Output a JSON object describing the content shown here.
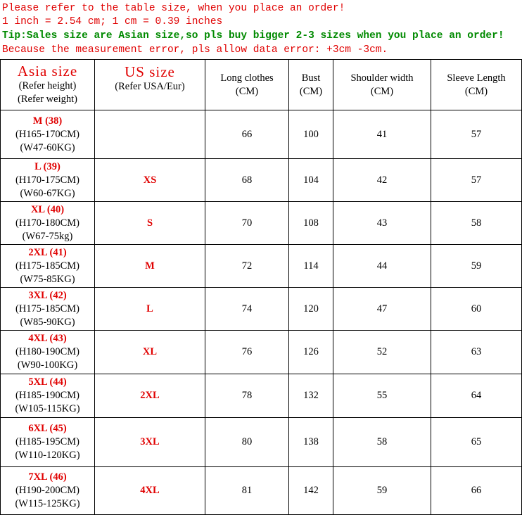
{
  "notes": [
    "Please refer to the table size, when you place an order!",
    "1 inch = 2.54 cm; 1 cm = 0.39 inches",
    "Tip:Sales size are Asian size,so pls buy bigger 2-3 sizes when you place an order!",
    "Because the measurement error, pls allow data error: +3cm -3cm."
  ],
  "header": {
    "asia_title": "Asia size",
    "asia_sub1": "(Refer height)",
    "asia_sub2": "(Refer weight)",
    "us_title": "US size",
    "us_sub": "(Refer USA/Eur)",
    "long_clothes": "Long clothes",
    "long_unit": "(CM)",
    "bust": "Bust",
    "bust_unit": "(CM)",
    "shoulder": "Shoulder width",
    "shoulder_unit": "(CM)",
    "sleeve": "Sleeve Length",
    "sleeve_unit": "(CM)"
  },
  "rows": [
    {
      "asia": "M (38)",
      "height": "(H165-170CM)",
      "weight": "(W47-60KG)",
      "us": "",
      "long": "66",
      "bust": "100",
      "shoulder": "41",
      "sleeve": "57"
    },
    {
      "asia": "L (39)",
      "height": "(H170-175CM)",
      "weight": "(W60-67KG)",
      "us": "XS",
      "long": "68",
      "bust": "104",
      "shoulder": "42",
      "sleeve": "57"
    },
    {
      "asia": "XL (40)",
      "height": "(H170-180CM)",
      "weight": "(W67-75kg)",
      "us": "S",
      "long": "70",
      "bust": "108",
      "shoulder": "43",
      "sleeve": "58"
    },
    {
      "asia": "2XL (41)",
      "height": "(H175-185CM)",
      "weight": "(W75-85KG)",
      "us": "M",
      "long": "72",
      "bust": "114",
      "shoulder": "44",
      "sleeve": "59"
    },
    {
      "asia": "3XL (42)",
      "height": "(H175-185CM)",
      "weight": "(W85-90KG)",
      "us": "L",
      "long": "74",
      "bust": "120",
      "shoulder": "47",
      "sleeve": "60"
    },
    {
      "asia": "4XL (43)",
      "height": "(H180-190CM)",
      "weight": "(W90-100KG)",
      "us": "XL",
      "long": "76",
      "bust": "126",
      "shoulder": "52",
      "sleeve": "63"
    },
    {
      "asia": "5XL (44)",
      "height": "(H185-190CM)",
      "weight": "(W105-115KG)",
      "us": "2XL",
      "long": "78",
      "bust": "132",
      "shoulder": "55",
      "sleeve": "64"
    },
    {
      "asia": "6XL (45)",
      "height": "(H185-195CM)",
      "weight": "(W110-120KG)",
      "us": "3XL",
      "long": "80",
      "bust": "138",
      "shoulder": "58",
      "sleeve": "65"
    },
    {
      "asia": "7XL (46)",
      "height": "(H190-200CM)",
      "weight": "(W115-125KG)",
      "us": "4XL",
      "long": "81",
      "bust": "142",
      "shoulder": "59",
      "sleeve": "66"
    }
  ]
}
